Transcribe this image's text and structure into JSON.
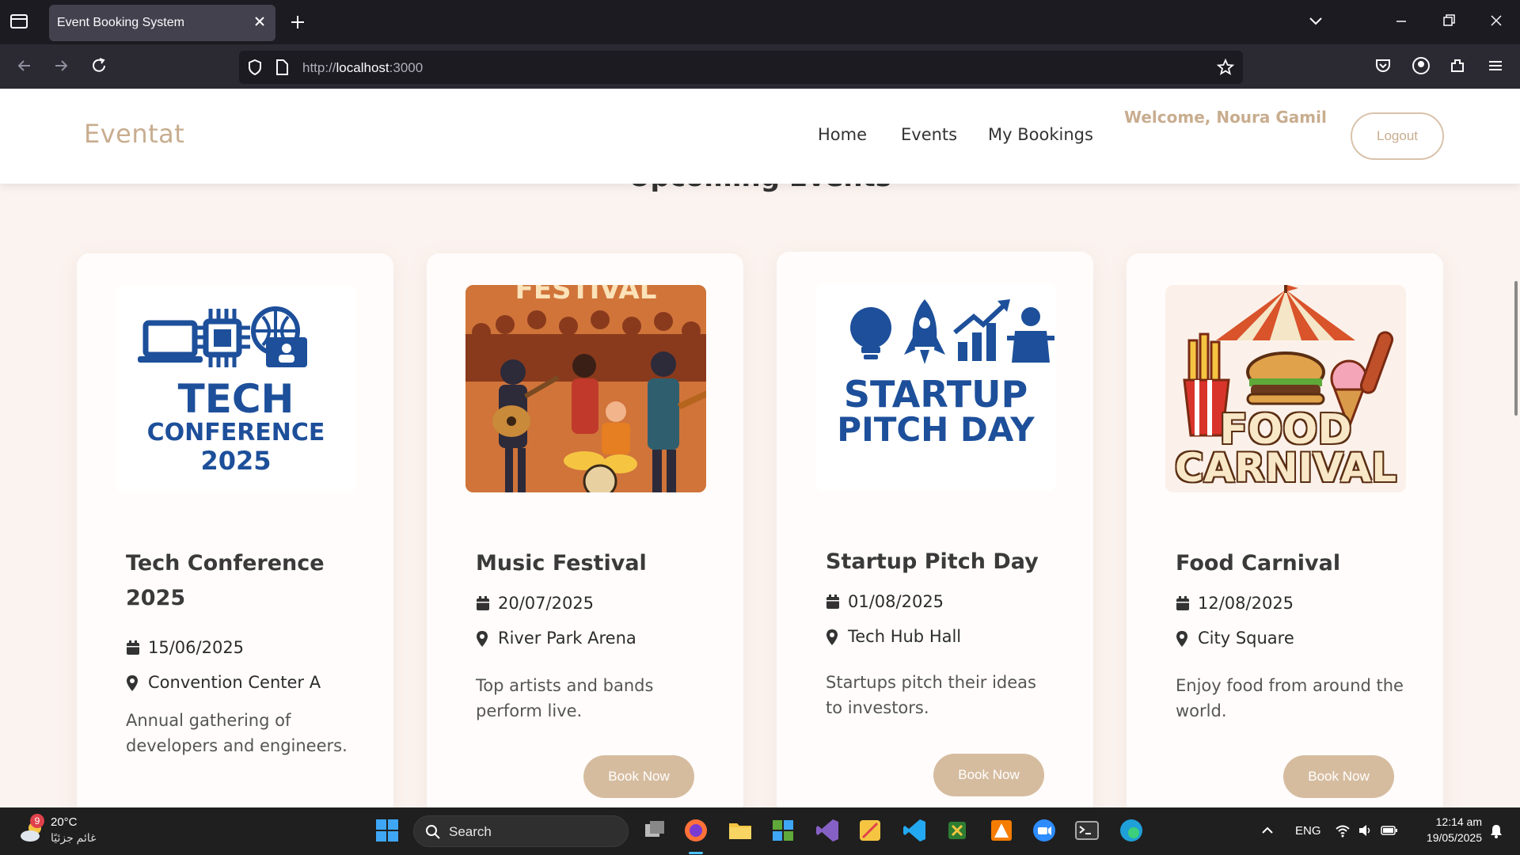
{
  "browser": {
    "tab_title": "Event Booking System",
    "url_scheme": "http://",
    "url_host": "localhost",
    "url_port": ":3000"
  },
  "site": {
    "brand": "Eventat",
    "nav": [
      "Home",
      "Events",
      "My Bookings"
    ],
    "welcome": "Welcome, Noura Gamil",
    "logout_label": "Logout",
    "section_title": "Upcoming Events",
    "accent_color": "#c8ad8f",
    "button_color": "#d6bc9f"
  },
  "events": [
    {
      "title": "Tech Conference 2025",
      "date": "15/06/2025",
      "location": "Convention Center A",
      "description": "Annual gathering of developers and engineers.",
      "image": {
        "line1": "TECH",
        "line2": "CONFERENCE",
        "line3": "2025"
      }
    },
    {
      "title": "Music Festival",
      "date": "20/07/2025",
      "location": "River Park Arena",
      "description": "Top artists and bands perform live.",
      "button": "Book Now",
      "image": {
        "banner": "FESTIVAL"
      }
    },
    {
      "title": "Startup Pitch Day",
      "date": "01/08/2025",
      "location": "Tech Hub Hall",
      "description": "Startups pitch their ideas to investors.",
      "button": "Book Now",
      "image": {
        "line1": "STARTUP",
        "line2": "PITCH DAY"
      }
    },
    {
      "title": "Food Carnival",
      "date": "12/08/2025",
      "location": "City Square",
      "description": "Enjoy food from around the world.",
      "button": "Book Now",
      "image": {
        "line1": "FOOD",
        "line2": "CARNIVAL"
      }
    }
  ],
  "taskbar": {
    "weather_temp": "20°C",
    "weather_desc": "غائم جزئيًا",
    "weather_badge": "9",
    "search_label": "Search",
    "language": "ENG",
    "time": "12:14 am",
    "date": "19/05/2025"
  }
}
